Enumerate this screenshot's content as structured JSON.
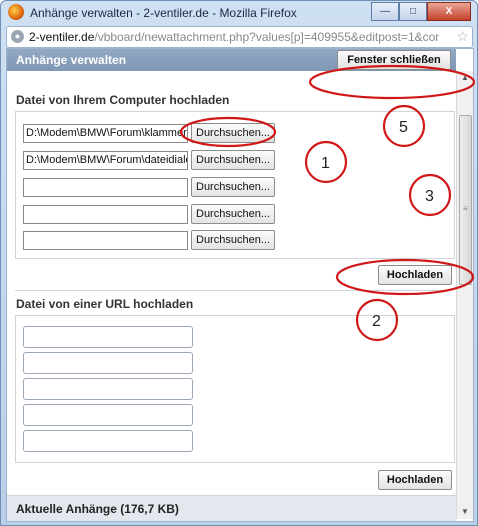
{
  "window": {
    "title": "Anhänge verwalten - 2-ventiler.de - Mozilla Firefox",
    "minimize": "—",
    "maximize": "□",
    "close": "X"
  },
  "urlbar": {
    "domain": "2-ventiler.de",
    "path": "/vbboard/newattachment.php?values[p]=409955&editpost=1&cor"
  },
  "header": {
    "title": "Anhänge verwalten",
    "close_button": "Fenster schließen"
  },
  "upload_computer": {
    "title": "Datei von Ihrem Computer hochladen",
    "files": [
      {
        "value": "D:\\Modem\\BMW\\Forum\\klammer.jp",
        "browse": "Durchsuchen..."
      },
      {
        "value": "D:\\Modem\\BMW\\Forum\\dateidialog",
        "browse": "Durchsuchen..."
      },
      {
        "value": "",
        "browse": "Durchsuchen..."
      },
      {
        "value": "",
        "browse": "Durchsuchen..."
      },
      {
        "value": "",
        "browse": "Durchsuchen..."
      }
    ],
    "upload_button": "Hochladen"
  },
  "upload_url": {
    "title": "Datei von einer URL hochladen",
    "upload_button": "Hochladen"
  },
  "footer": {
    "title": "Aktuelle Anhänge (176,7 KB)"
  },
  "annotations": [
    "1",
    "2",
    "3",
    "5"
  ],
  "colors": {
    "annotation": "#d01818",
    "header": "#8aa0bd"
  }
}
